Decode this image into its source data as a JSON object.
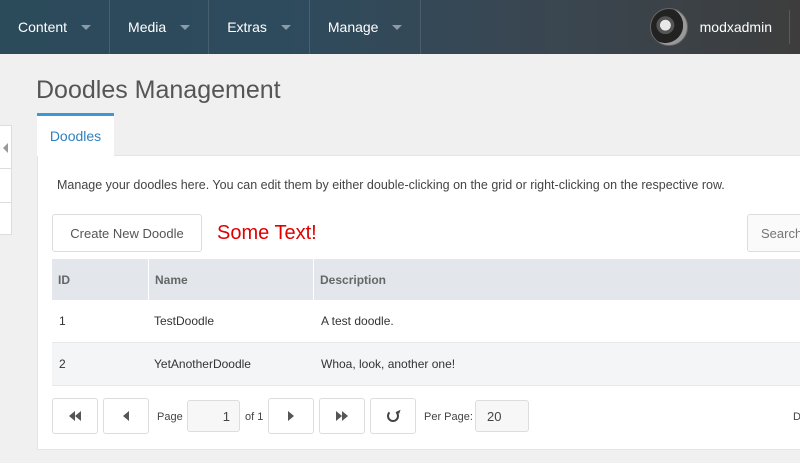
{
  "nav": {
    "items": [
      {
        "label": "Content"
      },
      {
        "label": "Media"
      },
      {
        "label": "Extras"
      },
      {
        "label": "Manage"
      }
    ],
    "user": "modxadmin"
  },
  "page": {
    "title": "Doodles Management",
    "tab": "Doodles",
    "description": "Manage your doodles here. You can edit them by either double-clicking on the grid or right-clicking on the respective row."
  },
  "toolbar": {
    "create_label": "Create New Doodle",
    "extra_text": "Some Text!",
    "search_placeholder": "Search"
  },
  "grid": {
    "columns": [
      "ID",
      "Name",
      "Description"
    ],
    "rows": [
      {
        "id": "1",
        "name": "TestDoodle",
        "description": "A test doodle."
      },
      {
        "id": "2",
        "name": "YetAnotherDoodle",
        "description": "Whoa, look, another one!"
      }
    ]
  },
  "pager": {
    "page_label": "Page",
    "page_value": "1",
    "of_label": "of 1",
    "per_page_label": "Per Page:",
    "per_page_value": "20",
    "right_text": "D"
  },
  "colors": {
    "accent": "#3b99d5",
    "highlight_text": "#e00000"
  }
}
